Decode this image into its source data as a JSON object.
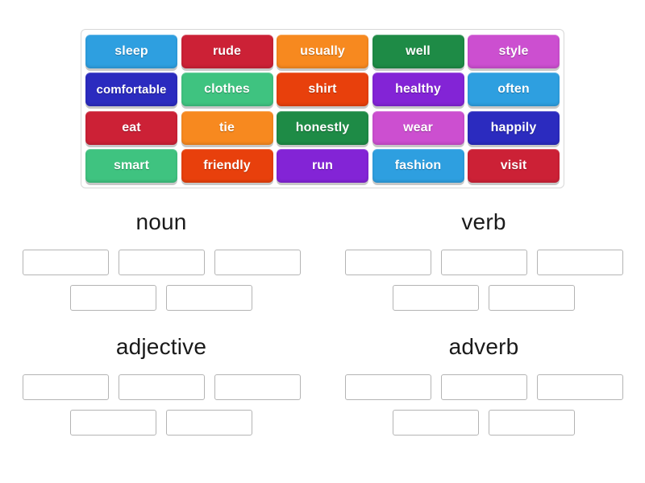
{
  "activity": {
    "type": "group-sort",
    "word_bank": {
      "rows": [
        [
          {
            "label": "sleep",
            "color": "#2e9fe0"
          },
          {
            "label": "rude",
            "color": "#cc2136"
          },
          {
            "label": "usually",
            "color": "#f7891f"
          },
          {
            "label": "well",
            "color": "#1e8b46"
          },
          {
            "label": "style",
            "color": "#cc4fd0"
          }
        ],
        [
          {
            "label": "comfortable",
            "color": "#2b2bbf"
          },
          {
            "label": "clothes",
            "color": "#3fc380"
          },
          {
            "label": "shirt",
            "color": "#e8400c"
          },
          {
            "label": "healthy",
            "color": "#8324d6"
          },
          {
            "label": "often",
            "color": "#2e9fe0"
          }
        ],
        [
          {
            "label": "eat",
            "color": "#cc2136"
          },
          {
            "label": "tie",
            "color": "#f7891f"
          },
          {
            "label": "honestly",
            "color": "#1e8b46"
          },
          {
            "label": "wear",
            "color": "#cc4fd0"
          },
          {
            "label": "happily",
            "color": "#2b2bbf"
          }
        ],
        [
          {
            "label": "smart",
            "color": "#3fc380"
          },
          {
            "label": "friendly",
            "color": "#e8400c"
          },
          {
            "label": "run",
            "color": "#8324d6"
          },
          {
            "label": "fashion",
            "color": "#2e9fe0"
          },
          {
            "label": "visit",
            "color": "#cc2136"
          }
        ]
      ]
    },
    "categories": [
      {
        "title": "noun",
        "slot_rows": [
          3,
          2
        ],
        "slots": [
          "",
          "",
          "",
          "",
          ""
        ]
      },
      {
        "title": "verb",
        "slot_rows": [
          3,
          2
        ],
        "slots": [
          "",
          "",
          "",
          "",
          ""
        ]
      },
      {
        "title": "adjective",
        "slot_rows": [
          3,
          2
        ],
        "slots": [
          "",
          "",
          "",
          "",
          ""
        ]
      },
      {
        "title": "adverb",
        "slot_rows": [
          3,
          2
        ],
        "slots": [
          "",
          "",
          "",
          "",
          ""
        ]
      }
    ]
  }
}
